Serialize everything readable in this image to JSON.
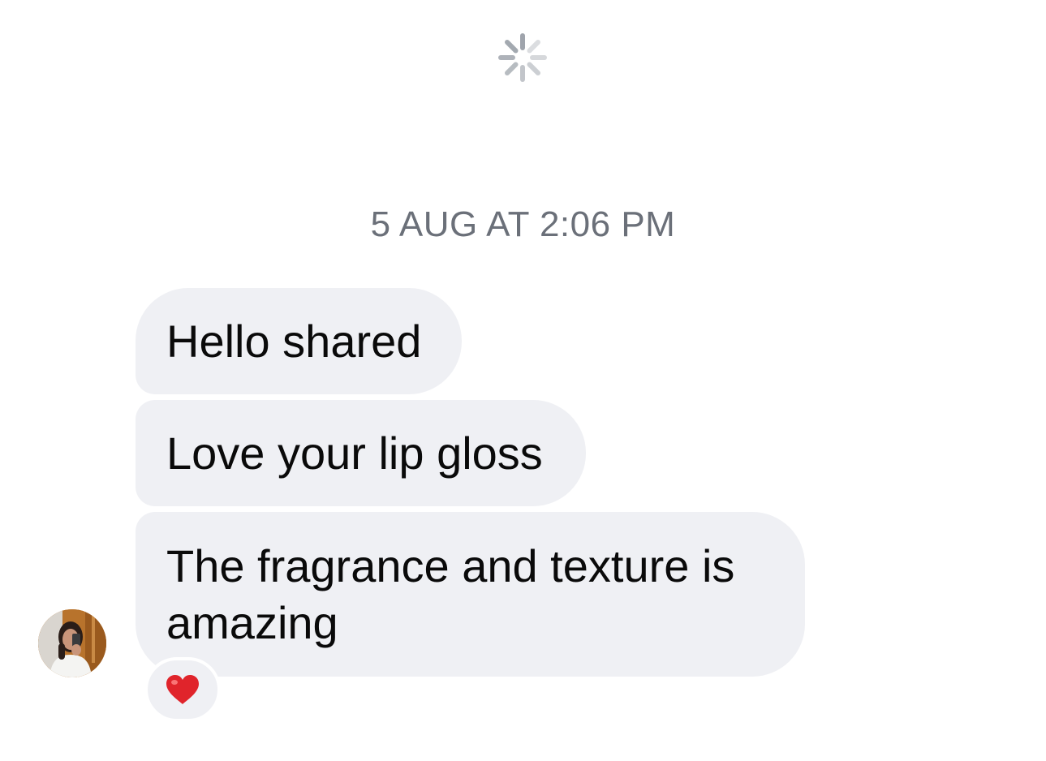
{
  "thread": {
    "loading_icon": "spinner-icon",
    "timestamp": "5 AUG AT 2:06 PM",
    "messages": [
      {
        "text": "Hello shared"
      },
      {
        "text": "Love your lip gloss"
      },
      {
        "text": "The fragrance and texture is amazing"
      }
    ],
    "reaction": {
      "emoji": "❤️",
      "icon": "heart-icon"
    }
  },
  "sender": {
    "avatar_icon": "avatar"
  },
  "colors": {
    "bubble": "#eff0f4",
    "timestamp": "#6b7079",
    "spinner": "#9aa0a8",
    "heart": "#e0242b"
  }
}
